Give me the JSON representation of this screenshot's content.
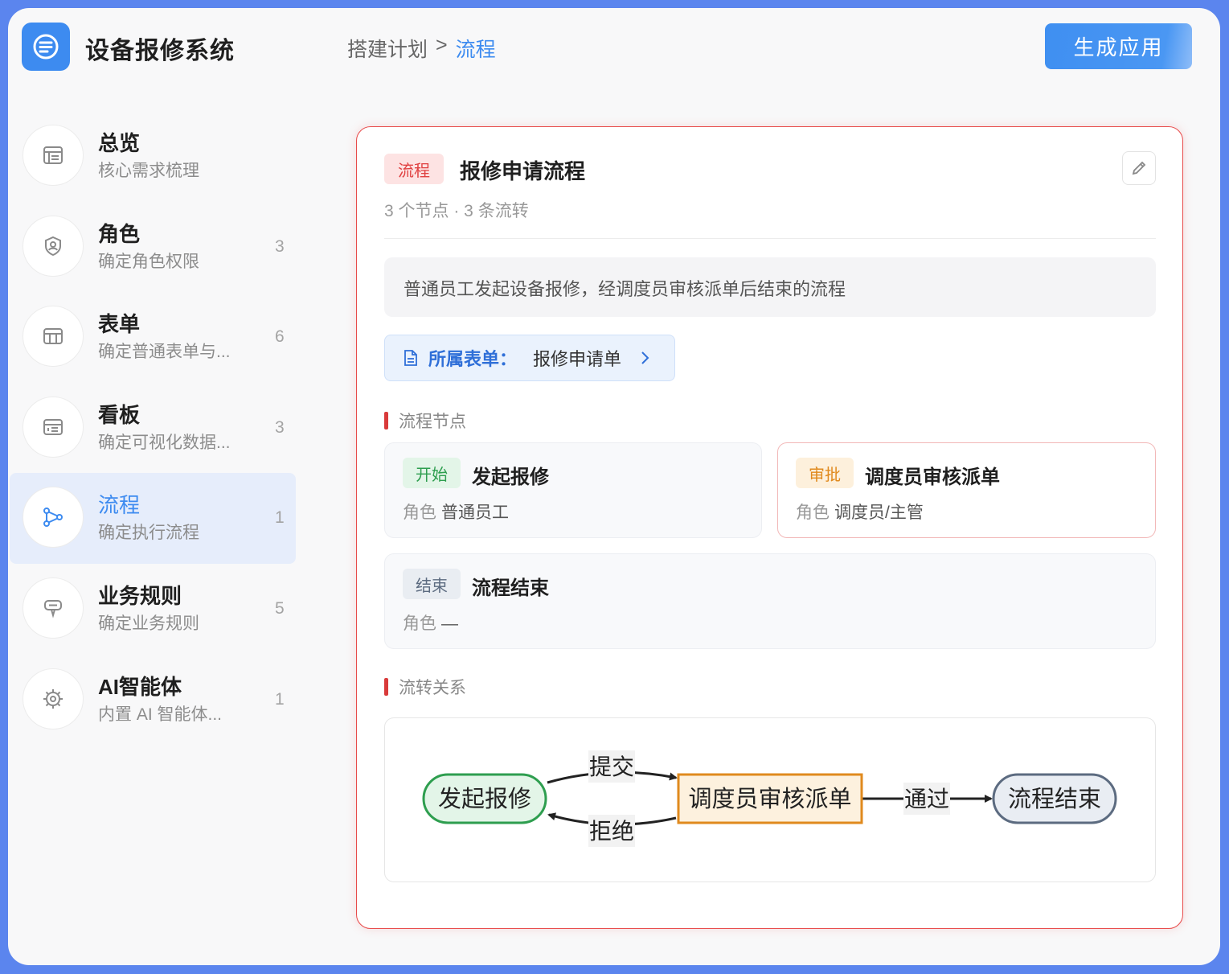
{
  "app": {
    "title": "设备报修系统",
    "generate_label": "生成应用"
  },
  "breadcrumb": {
    "parent": "搭建计划",
    "separator": ">",
    "current": "流程"
  },
  "sidebar": {
    "items": [
      {
        "label": "总览",
        "sub": "核心需求梳理",
        "count": "",
        "icon": "overview-icon"
      },
      {
        "label": "角色",
        "sub": "确定角色权限",
        "count": "3",
        "icon": "shield-user-icon"
      },
      {
        "label": "表单",
        "sub": "确定普通表单与...",
        "count": "6",
        "icon": "table-icon"
      },
      {
        "label": "看板",
        "sub": "确定可视化数据...",
        "count": "3",
        "icon": "dashboard-icon"
      },
      {
        "label": "流程",
        "sub": "确定执行流程",
        "count": "1",
        "icon": "flow-icon",
        "active": true
      },
      {
        "label": "业务规则",
        "sub": "确定业务规则",
        "count": "5",
        "icon": "rule-icon"
      },
      {
        "label": "AI智能体",
        "sub": "内置 AI 智能体...",
        "count": "1",
        "icon": "ai-chip-icon"
      }
    ]
  },
  "card": {
    "tag": "流程",
    "title": "报修申请流程",
    "meta": "3 个节点 · 3 条流转",
    "description": "普通员工发起设备报修，经调度员审核派单后结束的流程",
    "form_link": {
      "label": "所属表单：",
      "value": "报修申请单"
    },
    "nodes_title": "流程节点",
    "transitions_title": "流转关系",
    "role_label": "角色",
    "nodes": [
      {
        "tag": "开始",
        "name": "发起报修",
        "role": "普通员工"
      },
      {
        "tag": "审批",
        "name": "调度员审核派单",
        "role": "调度员/主管"
      },
      {
        "tag": "结束",
        "name": "流程结束",
        "role": "—"
      }
    ],
    "diagram": {
      "start": "发起报修",
      "approve": "调度员审核派单",
      "end": "流程结束",
      "edge_submit": "提交",
      "edge_reject": "拒绝",
      "edge_pass": "通过"
    }
  },
  "colors": {
    "accent": "#3d8bf0",
    "danger": "#e04040",
    "start_green": "#2e9e4f",
    "approve_orange": "#e08a1e",
    "end_slate": "#5c6b80"
  }
}
